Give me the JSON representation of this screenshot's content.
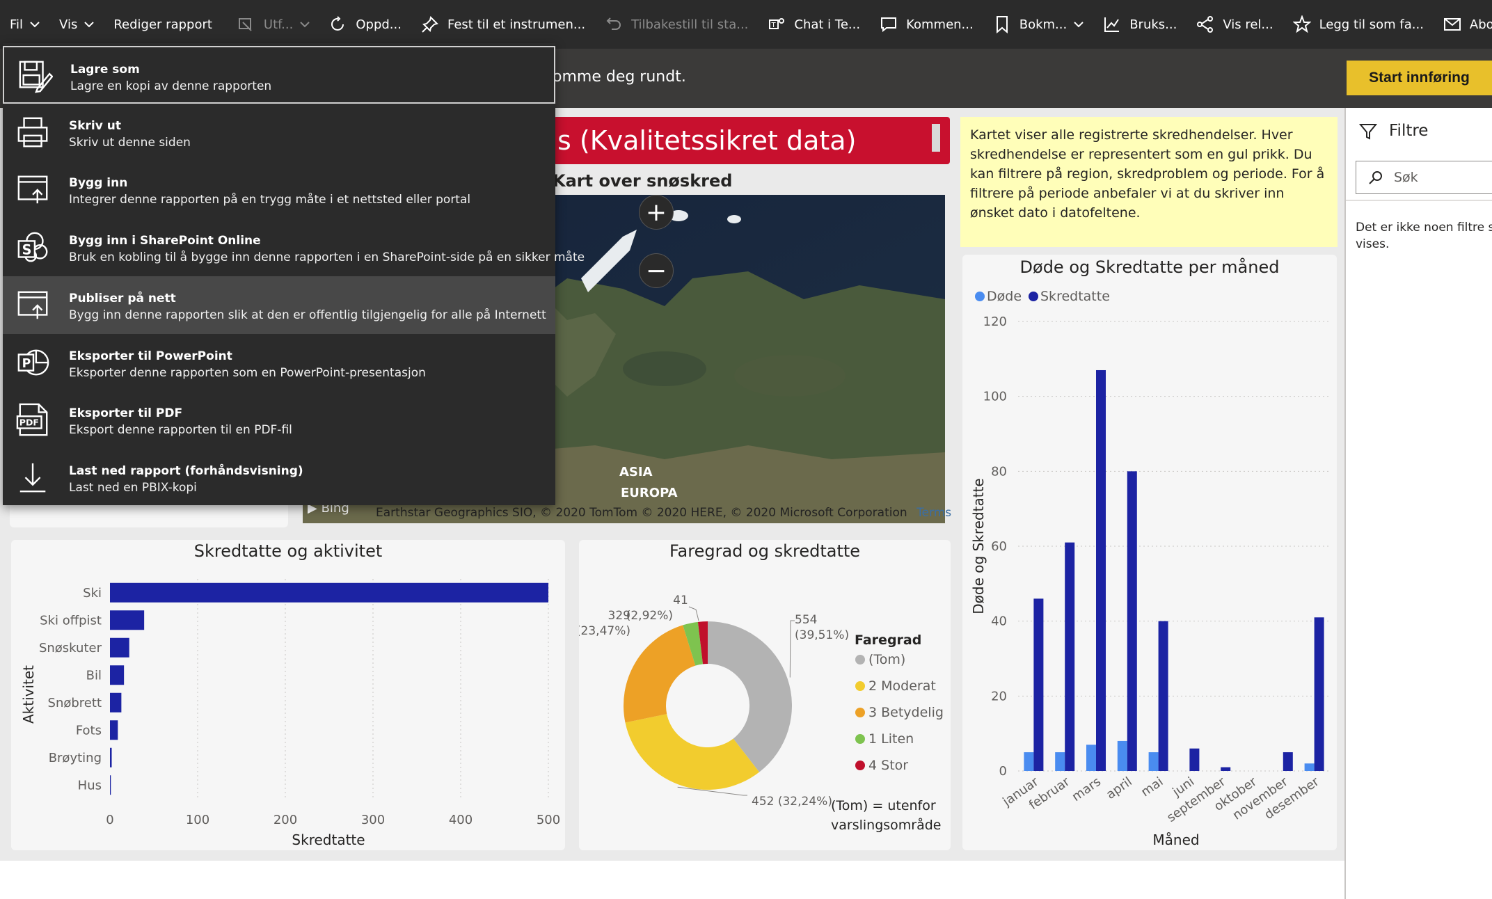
{
  "commandbar": {
    "items": [
      {
        "label": "Fil",
        "icon": "",
        "chevron": true,
        "disabled": false
      },
      {
        "label": "Vis",
        "icon": "",
        "chevron": true,
        "disabled": false
      },
      {
        "label": "Rediger rapport",
        "icon": "",
        "chevron": false,
        "disabled": false
      },
      {
        "label": "Utf...",
        "icon": "explore-icon",
        "chevron": true,
        "disabled": true
      },
      {
        "label": "Oppd...",
        "icon": "refresh-icon",
        "chevron": false,
        "disabled": false
      },
      {
        "label": "Fest til et instrumen...",
        "icon": "pin-icon",
        "chevron": false,
        "disabled": false
      },
      {
        "label": "Tilbakestill til sta...",
        "icon": "undo-icon",
        "chevron": false,
        "disabled": true
      },
      {
        "label": "Chat i Te...",
        "icon": "teams-icon",
        "chevron": false,
        "disabled": false
      },
      {
        "label": "Kommen...",
        "icon": "comment-icon",
        "chevron": false,
        "disabled": false
      },
      {
        "label": "Bokm...",
        "icon": "bookmark-icon",
        "chevron": true,
        "disabled": false
      },
      {
        "label": "Bruks...",
        "icon": "usage-chart-icon",
        "chevron": false,
        "disabled": false
      },
      {
        "label": "Vis rel...",
        "icon": "share-nodes-icon",
        "chevron": false,
        "disabled": false
      },
      {
        "label": "Legg til som fa...",
        "icon": "star-icon",
        "chevron": false,
        "disabled": false
      },
      {
        "label": "Abo...",
        "icon": "mail-icon",
        "chevron": false,
        "disabled": false
      }
    ],
    "share_icon": "share-icon"
  },
  "banner": {
    "text": "omme deg rundt.",
    "start_button": "Start innføring"
  },
  "file_menu": {
    "items": [
      {
        "title": "Lagre som",
        "desc": "Lagre en kopi av denne rapporten",
        "icon": "save-as-icon",
        "state": "focused"
      },
      {
        "title": "Skriv ut",
        "desc": "Skriv ut denne siden",
        "icon": "print-icon",
        "state": ""
      },
      {
        "title": "Bygg inn",
        "desc": "Integrer denne rapporten på en trygg måte i et nettsted eller portal",
        "icon": "embed-icon",
        "state": ""
      },
      {
        "title": "Bygg inn i SharePoint Online",
        "desc": "Bruk en kobling til å bygge inn denne rapporten i en SharePoint-side på en sikker måte",
        "icon": "sharepoint-icon",
        "state": ""
      },
      {
        "title": "Publiser på nett",
        "desc": "Bygg inn denne rapporten slik at den er offentlig tilgjengelig for alle på Internett",
        "icon": "publish-web-icon",
        "state": "hover"
      },
      {
        "title": "Eksporter til PowerPoint",
        "desc": "Eksporter denne rapporten som en PowerPoint-presentasjon",
        "icon": "powerpoint-icon",
        "state": ""
      },
      {
        "title": "Eksporter til PDF",
        "desc": "Eksport denne rapporten til en PDF-fil",
        "icon": "pdf-icon",
        "state": ""
      },
      {
        "title": "Last ned rapport (forhåndsvisning)",
        "desc": "Last ned en PBIX-kopi",
        "icon": "download-icon",
        "state": ""
      }
    ]
  },
  "report": {
    "title_fragment": "s (Kvalitetssikret data)",
    "map_title": "Kart over snøskred",
    "map_labels": {
      "europa": "EUROPA",
      "asia": "ASIA"
    },
    "map_attribution": "Earthstar Geographics SIO, © 2020 TomTom © 2020 HERE, © 2020 Microsoft Corporation",
    "map_terms": "Terms",
    "bing": "Bing",
    "zoom_in": "+",
    "zoom_out": "−",
    "info_text": "Kartet viser alle registrerte skredhendelser. Hver skredhendelse er representert som en gul prikk. Du kan filtrere på region, skredproblem og periode. For å filtrere på periode anbefaler vi at du skriver inn ønsket dato i datofeltene."
  },
  "filters": {
    "title": "Filtre",
    "search_placeholder": "Søk",
    "empty_text": "Det er ikke noen filtre som vises."
  },
  "chart_data": [
    {
      "type": "bar",
      "orientation": "horizontal",
      "title": "Skredtatte og aktivitet",
      "xlabel": "Skredtatte",
      "ylabel": "Aktivitet",
      "categories": [
        "Ski",
        "Ski offpist",
        "Snøskuter",
        "Bil",
        "Snøbrett",
        "Fots",
        "Brøyting",
        "Hus"
      ],
      "values": [
        500,
        39,
        22,
        16,
        13,
        9,
        2,
        1
      ],
      "xlim": [
        0,
        500
      ],
      "xticks": [
        0,
        100,
        200,
        300,
        400,
        500
      ],
      "color": "#1c23a3"
    },
    {
      "type": "pie",
      "variant": "donut",
      "title": "Faregrad og skredtatte",
      "legend_title": "Faregrad",
      "legend_position": "right",
      "footnote": "(Tom) = utenfor varslingsområde",
      "slices": [
        {
          "label": "(Tom)",
          "value": 554,
          "pct": "(39,51%)",
          "color": "#b3b3b3"
        },
        {
          "label": "2 Moderat",
          "value": 452,
          "pct": "(32,24%)",
          "color": "#f2cc2e"
        },
        {
          "label": "3 Betydelig",
          "value": 329,
          "pct": "(23,47%)",
          "color": "#eda126"
        },
        {
          "label": "1 Liten",
          "value": 41,
          "pct": "(2,92%)",
          "color": "#7ec34f"
        },
        {
          "label": "4 Stor",
          "value": 26,
          "pct": "",
          "color": "#c0102c"
        }
      ]
    },
    {
      "type": "bar",
      "orientation": "vertical",
      "title": "Døde og Skredtatte per måned",
      "xlabel": "Måned",
      "ylabel": "Døde og Skredtatte",
      "ylim": [
        0,
        120
      ],
      "yticks": [
        0,
        20,
        40,
        60,
        80,
        100,
        120
      ],
      "legend_position": "top-left",
      "categories": [
        "januar",
        "februar",
        "mars",
        "april",
        "mai",
        "juni",
        "september",
        "oktober",
        "november",
        "desember"
      ],
      "series": [
        {
          "name": "Døde",
          "color": "#4a8cf0",
          "values": [
            5,
            5,
            7,
            8,
            5,
            0,
            0,
            0,
            0,
            2
          ]
        },
        {
          "name": "Skredtatte",
          "color": "#1c23a3",
          "values": [
            46,
            61,
            107,
            80,
            40,
            6,
            1,
            0,
            5,
            41
          ]
        }
      ]
    }
  ]
}
